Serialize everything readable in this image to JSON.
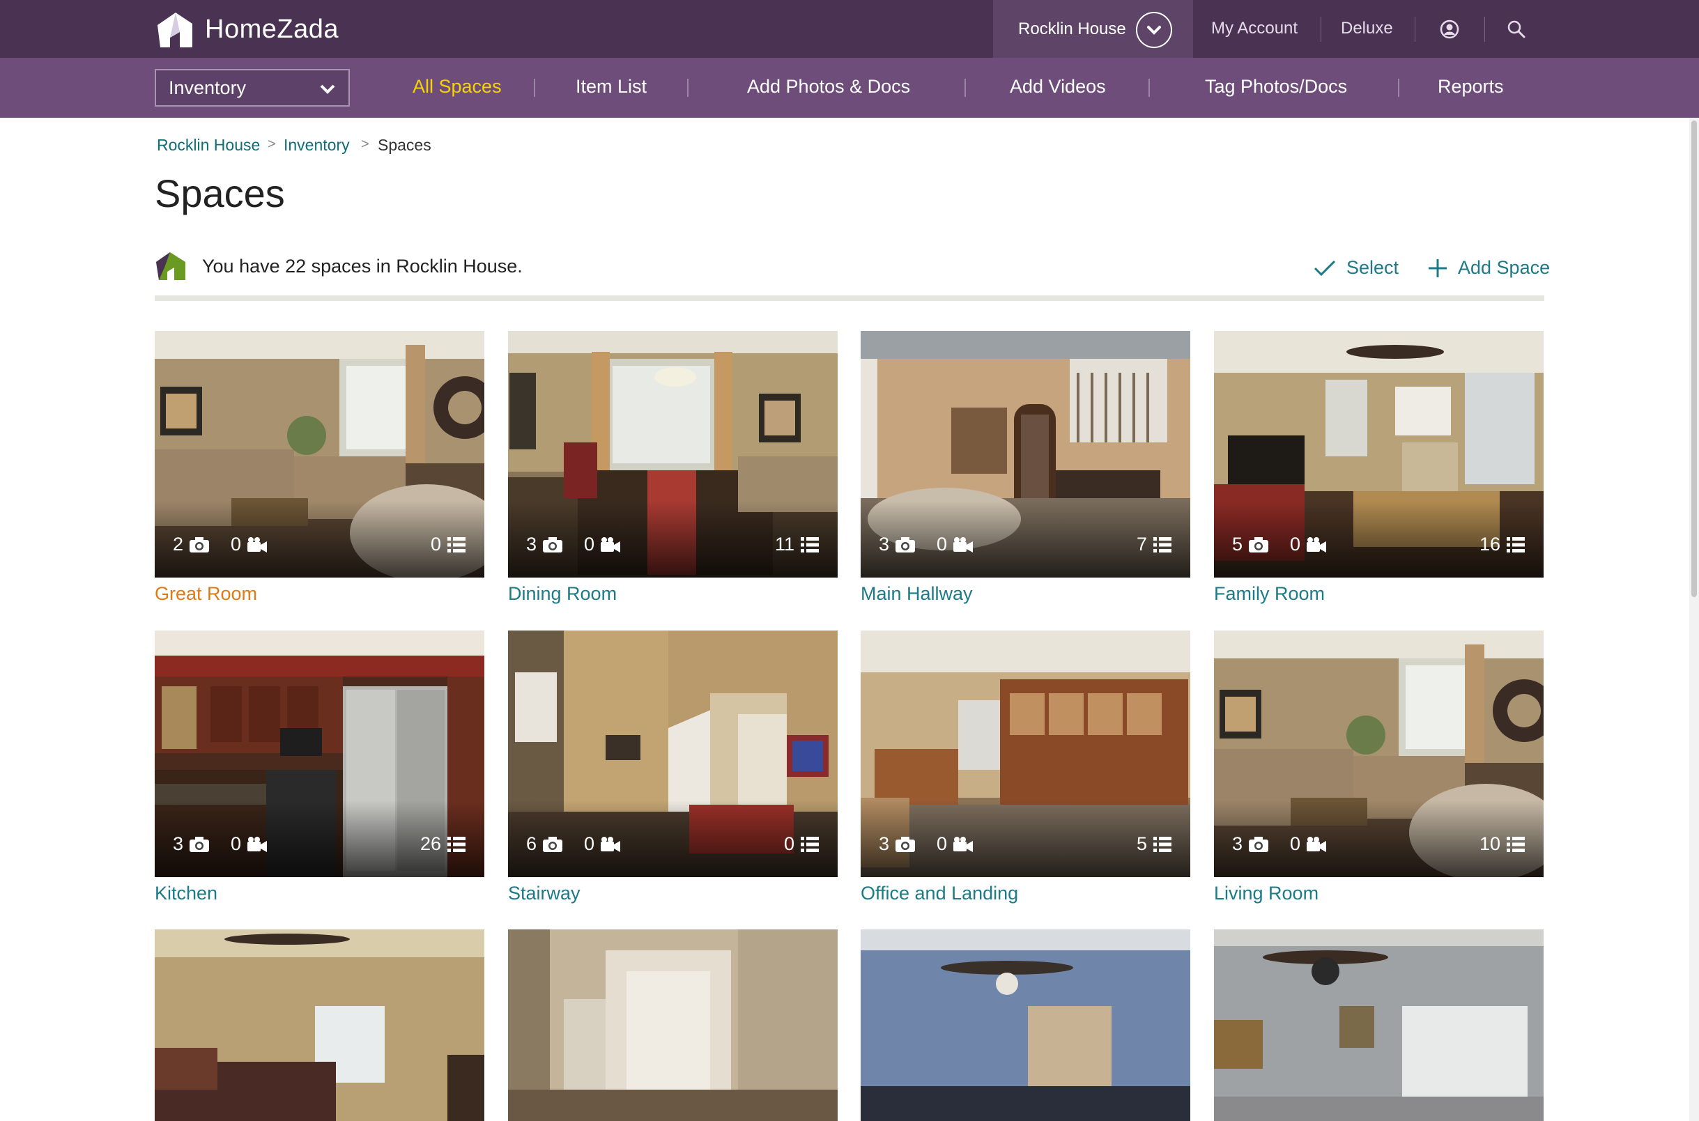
{
  "app": {
    "name": "HomeZada"
  },
  "header": {
    "house_selector": "Rocklin House",
    "my_account": "My Account",
    "plan": "Deluxe"
  },
  "nav": {
    "module_select": "Inventory",
    "items": [
      {
        "label": "All Spaces",
        "active": true
      },
      {
        "label": "Item List"
      },
      {
        "label": "Add Photos & Docs"
      },
      {
        "label": "Add Videos"
      },
      {
        "label": "Tag Photos/Docs"
      },
      {
        "label": "Reports"
      }
    ]
  },
  "breadcrumb": [
    "Rocklin House",
    "Inventory",
    "Spaces"
  ],
  "page": {
    "title": "Spaces",
    "summary": "You have 22 spaces in Rocklin House.",
    "select_label": "Select",
    "add_label": "Add Space"
  },
  "spaces": [
    {
      "name": "Great Room",
      "photos": "2",
      "videos": "0",
      "items": "0",
      "highlight": true
    },
    {
      "name": "Dining Room",
      "photos": "3",
      "videos": "0",
      "items": "11"
    },
    {
      "name": "Main Hallway",
      "photos": "3",
      "videos": "0",
      "items": "7"
    },
    {
      "name": "Family Room",
      "photos": "5",
      "videos": "0",
      "items": "16"
    },
    {
      "name": "Kitchen",
      "photos": "3",
      "videos": "0",
      "items": "26"
    },
    {
      "name": "Stairway",
      "photos": "6",
      "videos": "0",
      "items": "0"
    },
    {
      "name": "Office and Landing",
      "photos": "3",
      "videos": "0",
      "items": "5"
    },
    {
      "name": "Living Room",
      "photos": "3",
      "videos": "0",
      "items": "10"
    }
  ],
  "colors": {
    "topbar": "#4a3352",
    "navbar": "#6e4d7b",
    "active_nav": "#f5d400",
    "link": "#1c7b87",
    "highlight_title": "#e07a14"
  }
}
